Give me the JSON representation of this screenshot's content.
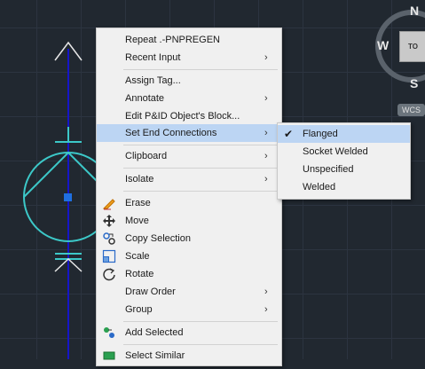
{
  "viewcube": {
    "north": "N",
    "west": "W",
    "south": "S",
    "top_face": "TO",
    "wcs": "WCS"
  },
  "menu": {
    "items": [
      {
        "label": "Repeat .-PNPREGEN"
      },
      {
        "label": "Recent Input",
        "arrow": "›"
      },
      {
        "label": "Assign Tag..."
      },
      {
        "label": "Annotate",
        "arrow": "›"
      },
      {
        "label": "Edit P&ID Object's Block..."
      },
      {
        "label": "Set End Connections",
        "arrow": "›"
      },
      {
        "label": "Clipboard",
        "arrow": "›"
      },
      {
        "label": "Isolate",
        "arrow": "›"
      },
      {
        "label": "Erase",
        "icon": "eraser-icon"
      },
      {
        "label": "Move",
        "icon": "move-icon"
      },
      {
        "label": "Copy Selection",
        "icon": "copy-selection-icon"
      },
      {
        "label": "Scale",
        "icon": "scale-icon"
      },
      {
        "label": "Rotate",
        "icon": "rotate-icon"
      },
      {
        "label": "Draw Order",
        "arrow": "›"
      },
      {
        "label": "Group",
        "arrow": "›"
      },
      {
        "label": "Add Selected",
        "icon": "add-selected-icon"
      },
      {
        "label": "Select Similar",
        "icon": "select-similar-icon"
      }
    ]
  },
  "submenu": {
    "items": [
      {
        "label": "Flanged",
        "checked": "✔"
      },
      {
        "label": "Socket Welded"
      },
      {
        "label": "Unspecified"
      },
      {
        "label": "Welded"
      }
    ]
  },
  "colors": {
    "background": "#212830",
    "pipe_line": "#1515c8",
    "symbol": "#3cc8c8",
    "highlight": "#bcd5f3"
  }
}
